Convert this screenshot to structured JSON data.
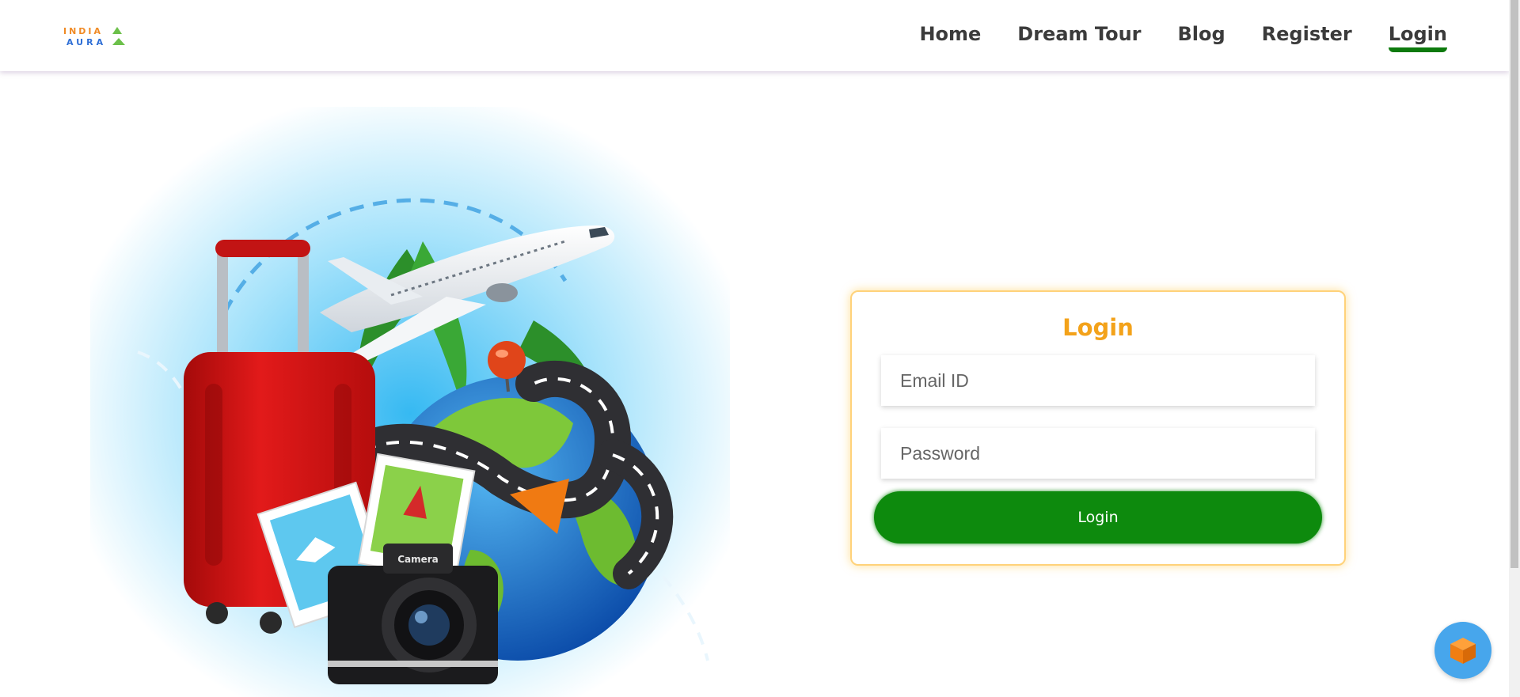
{
  "header": {
    "logo_text_top": "INDIA",
    "logo_text_bottom": "AURA",
    "nav": [
      {
        "label": "Home"
      },
      {
        "label": "Dream Tour"
      },
      {
        "label": "Blog"
      },
      {
        "label": "Register"
      },
      {
        "label": "Login",
        "active": true
      }
    ]
  },
  "hero": {
    "camera_label": "Camera"
  },
  "login_form": {
    "title": "Login",
    "email_placeholder": "Email ID",
    "password_placeholder": "Password",
    "submit_label": "Login"
  },
  "chat_widget": {
    "icon": "cube-icon"
  },
  "colors": {
    "accent_orange": "#f3a21a",
    "button_green": "#0d8a0d",
    "nav_underline": "#0d7a0d",
    "card_border": "#ffd27a",
    "chat_blue": "#47a6ec"
  }
}
